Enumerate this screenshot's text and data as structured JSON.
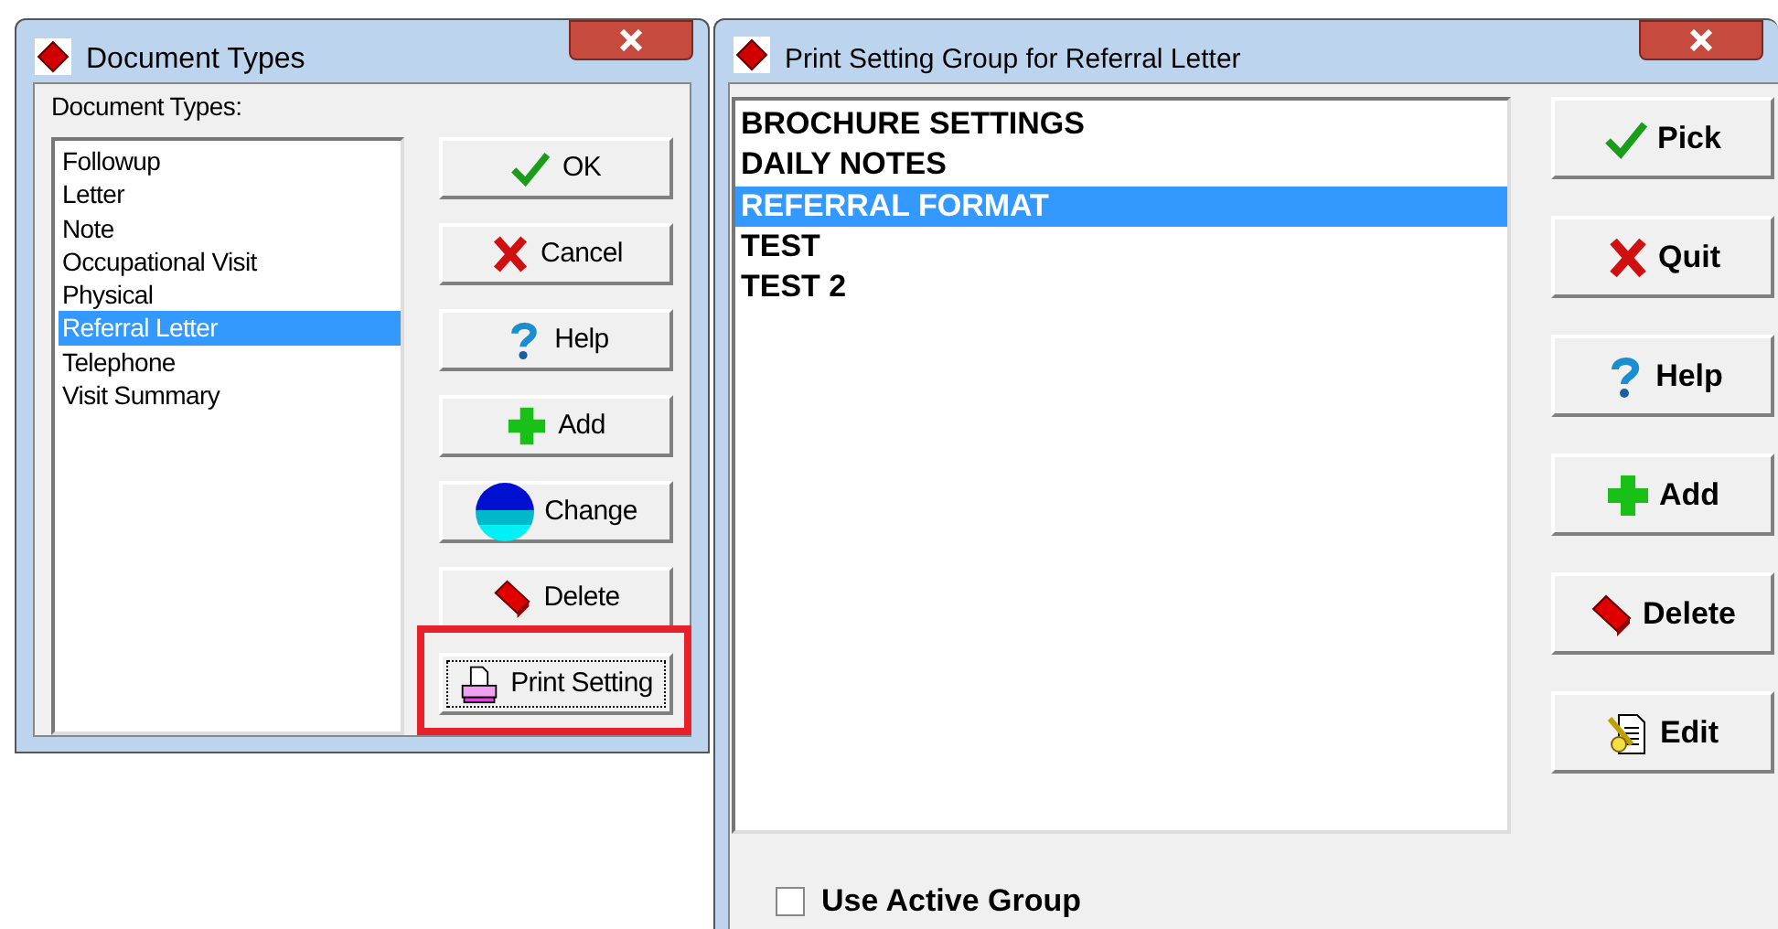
{
  "windows": [
    {
      "title": "Document Types",
      "list_label": "Document Types:",
      "items": [
        {
          "label": "Followup",
          "selected": false
        },
        {
          "label": "Letter",
          "selected": false
        },
        {
          "label": "Note",
          "selected": false
        },
        {
          "label": "Occupational Visit",
          "selected": false
        },
        {
          "label": "Physical",
          "selected": false
        },
        {
          "label": "Referral Letter",
          "selected": true
        },
        {
          "label": "Telephone",
          "selected": false
        },
        {
          "label": "Visit Summary",
          "selected": false
        }
      ],
      "buttons": [
        {
          "label": "OK",
          "kind": "check",
          "highlighted": false
        },
        {
          "label": "Cancel",
          "kind": "cross",
          "highlighted": false
        },
        {
          "label": "Help",
          "kind": "question",
          "highlighted": false
        },
        {
          "label": "Add",
          "kind": "plus",
          "highlighted": false
        },
        {
          "label": "Change",
          "kind": "globe",
          "highlighted": false
        },
        {
          "label": "Delete",
          "kind": "eraser",
          "highlighted": false
        },
        {
          "label": "Print Setting",
          "kind": "printer",
          "highlighted": true
        }
      ]
    },
    {
      "title": "Print Setting Group for Referral Letter",
      "items": [
        {
          "label": "BROCHURE SETTINGS",
          "selected": false
        },
        {
          "label": "DAILY NOTES",
          "selected": false
        },
        {
          "label": "REFERRAL FORMAT",
          "selected": true
        },
        {
          "label": "TEST",
          "selected": false
        },
        {
          "label": "TEST 2",
          "selected": false
        }
      ],
      "buttons": [
        {
          "label": "Pick",
          "kind": "check",
          "highlighted": false
        },
        {
          "label": "Quit",
          "kind": "cross",
          "highlighted": false
        },
        {
          "label": "Help",
          "kind": "question",
          "highlighted": false
        },
        {
          "label": "Add",
          "kind": "plus",
          "highlighted": false
        },
        {
          "label": "Delete",
          "kind": "eraser",
          "highlighted": false
        },
        {
          "label": "Edit",
          "kind": "edit",
          "highlighted": false
        }
      ],
      "checkbox": {
        "label": "Use Active Group",
        "checked": false
      }
    }
  ]
}
